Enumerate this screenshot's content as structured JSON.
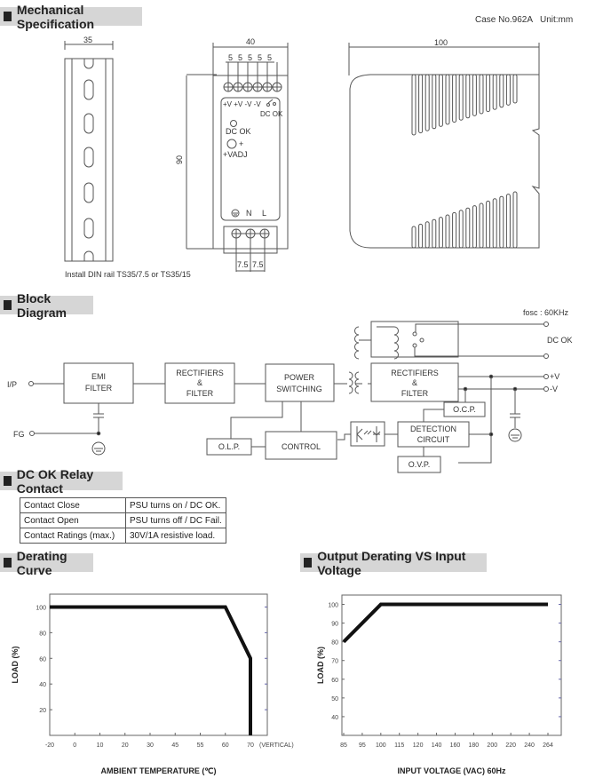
{
  "sections": {
    "mechanical": "Mechanical Specification",
    "block": "Block Diagram",
    "relay": "DC OK Relay Contact",
    "derating": "Derating Curve",
    "output_derating": "Output Derating VS Input Voltage"
  },
  "mechanical": {
    "case_no": "Case No.962A",
    "unit": "Unit:mm",
    "din_width": "35",
    "front_width": "40",
    "terminal_pitch": [
      "5",
      "5",
      "5",
      "5",
      "5"
    ],
    "height": "90",
    "depth": "100",
    "terminal_labels": "+V +V -V -V",
    "dcok_contact_label": "DC OK",
    "dcok_led_label": "DC OK",
    "vadj_label": "+VADJ",
    "vadj_plus": "+",
    "input_labels": [
      "N",
      "L"
    ],
    "input_pitch": [
      "7.5",
      "7.5"
    ],
    "din_note": "Install DIN rail TS35/7.5 or TS35/15"
  },
  "block": {
    "fosc": "fosc : 60KHz",
    "ip": "I/P",
    "fg": "FG",
    "emi": [
      "EMI",
      "FILTER"
    ],
    "rect1": [
      "RECTIFIERS",
      "&",
      "FILTER"
    ],
    "power": [
      "POWER",
      "SWITCHING"
    ],
    "rect2": [
      "RECTIFIERS",
      "&",
      "FILTER"
    ],
    "control": "CONTROL",
    "olp": "O.L.P.",
    "ocp": "O.C.P.",
    "ovp": "O.V.P.",
    "detection": [
      "DETECTION",
      "CIRCUIT"
    ],
    "dcok": "DC OK",
    "vplus": "+V",
    "vminus": "-V"
  },
  "relay_table": [
    {
      "condition": "Contact Close",
      "result": "PSU turns on / DC OK."
    },
    {
      "condition": "Contact Open",
      "result": "PSU turns off / DC Fail."
    },
    {
      "condition": "Contact Ratings (max.)",
      "result": "30V/1A resistive load."
    }
  ],
  "chart_data": [
    {
      "type": "line",
      "title": "Derating Curve",
      "xlabel": "AMBIENT TEMPERATURE (℃)",
      "ylabel": "LOAD (%)",
      "x_ticks": [
        "-20",
        "0",
        "10",
        "20",
        "30",
        "45",
        "55",
        "60",
        "70"
      ],
      "x_extra_label": "(VERTICAL)",
      "y_ticks": [
        20,
        40,
        60,
        80,
        100
      ],
      "ylim": [
        0,
        110
      ],
      "grid": false,
      "series": [
        {
          "name": "Load",
          "points": [
            [
              "-20",
              100
            ],
            [
              "60",
              100
            ],
            [
              "70",
              60
            ],
            [
              "70",
              0
            ]
          ]
        }
      ]
    },
    {
      "type": "line",
      "title": "Output Derating VS Input Voltage",
      "xlabel": "INPUT VOLTAGE (VAC) 60Hz",
      "ylabel": "LOAD (%)",
      "x_ticks": [
        "85",
        "95",
        "100",
        "115",
        "120",
        "140",
        "160",
        "180",
        "200",
        "220",
        "240",
        "264"
      ],
      "y_ticks": [
        40,
        50,
        60,
        70,
        80,
        90,
        100
      ],
      "ylim": [
        30,
        105
      ],
      "grid": false,
      "series": [
        {
          "name": "Load",
          "points": [
            [
              "85",
              80
            ],
            [
              "100",
              100
            ],
            [
              "264",
              100
            ]
          ]
        }
      ]
    }
  ]
}
